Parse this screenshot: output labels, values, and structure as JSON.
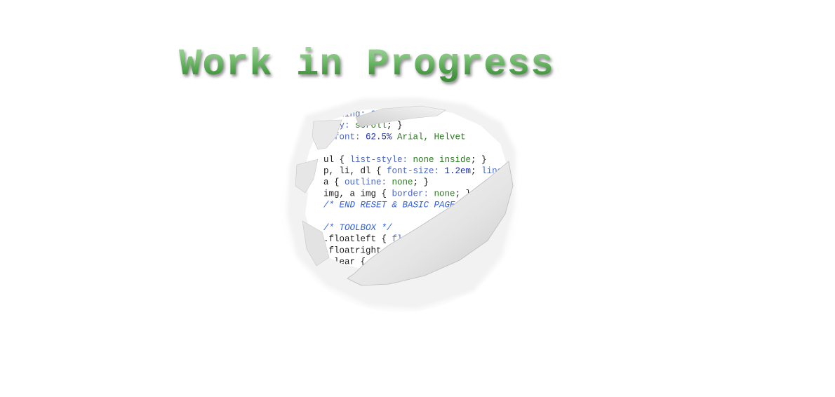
{
  "heading": "Work in Progress",
  "code_lines": [
    [
      {
        "t": "padding: 0; }",
        "c": "c-prop"
      }
    ],
    [
      {
        "t": "ow-y: ",
        "c": "c-prop"
      },
      {
        "t": "scroll",
        "c": "c-val"
      },
      {
        "t": "; }",
        "c": "c-sel"
      }
    ],
    [
      {
        "t": "{ ",
        "c": "c-sel"
      },
      {
        "t": "font: ",
        "c": "c-prop"
      },
      {
        "t": "62.5%",
        "c": "c-num"
      },
      {
        "t": " Arial, Helvet",
        "c": "c-val"
      }
    ],
    [
      {
        "t": "",
        "c": "c-sel"
      }
    ],
    [
      {
        "t": "ul { ",
        "c": "c-sel"
      },
      {
        "t": "list-style: ",
        "c": "c-prop"
      },
      {
        "t": "none inside",
        "c": "c-val"
      },
      {
        "t": "; }",
        "c": "c-sel"
      }
    ],
    [
      {
        "t": "p, li, dl { ",
        "c": "c-sel"
      },
      {
        "t": "font-size: ",
        "c": "c-prop"
      },
      {
        "t": "1.2em",
        "c": "c-num"
      },
      {
        "t": "; ",
        "c": "c-sel"
      },
      {
        "t": "line-",
        "c": "c-prop"
      }
    ],
    [
      {
        "t": "a { ",
        "c": "c-sel"
      },
      {
        "t": "outline: ",
        "c": "c-prop"
      },
      {
        "t": "none",
        "c": "c-val"
      },
      {
        "t": "; }",
        "c": "c-sel"
      }
    ],
    [
      {
        "t": "img, a img { ",
        "c": "c-sel"
      },
      {
        "t": "border: ",
        "c": "c-prop"
      },
      {
        "t": "none",
        "c": "c-val"
      },
      {
        "t": "; }",
        "c": "c-sel"
      }
    ],
    [
      {
        "t": "/* END RESET & BASIC PAGE",
        "c": "c-comment"
      }
    ],
    [
      {
        "t": "",
        "c": "c-sel"
      }
    ],
    [
      {
        "t": "/* TOOLBOX */",
        "c": "c-comment"
      }
    ],
    [
      {
        "t": ".floatleft { ",
        "c": "c-sel"
      },
      {
        "t": "fl",
        "c": "c-prop"
      }
    ],
    [
      {
        "t": ".floatright",
        "c": "c-sel"
      }
    ],
    [
      {
        "t": ".clear {",
        "c": "c-sel"
      }
    ]
  ]
}
